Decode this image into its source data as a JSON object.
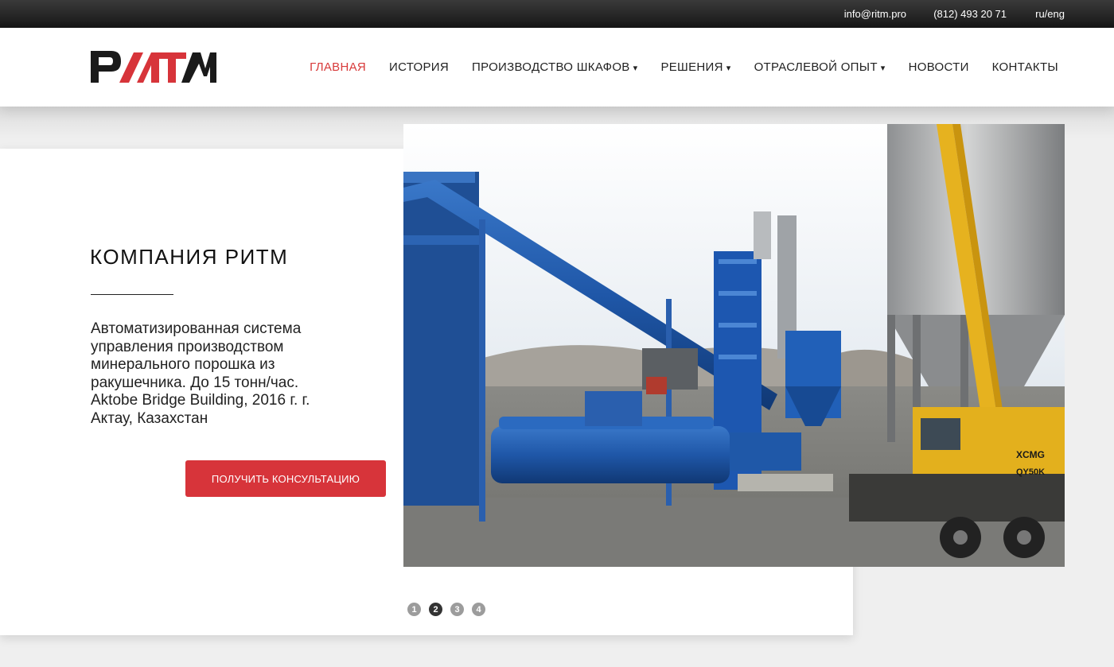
{
  "topbar": {
    "email": "info@ritm.pro",
    "phone": "(812) 493 20 71",
    "lang": "ru/eng"
  },
  "logo": {
    "text": "РИТМ"
  },
  "nav": [
    {
      "label": "ГЛАВНАЯ",
      "active": true
    },
    {
      "label": "ИСТОРИЯ"
    },
    {
      "label": "ПРОИЗВОДСТВО ШКАФОВ",
      "dropdown": true
    },
    {
      "label": "РЕШЕНИЯ",
      "dropdown": true
    },
    {
      "label": "ОТРАСЛЕВОЙ ОПЫТ",
      "dropdown": true
    },
    {
      "label": "НОВОСТИ"
    },
    {
      "label": "КОНТАКТЫ"
    }
  ],
  "caret": "▾",
  "slide": {
    "title": "КОМПАНИЯ РИТМ",
    "text": "Автоматизированная система управления производством минерального порошка из ракушечника. До 15 тонн/час. Aktobe Bridge Building, 2016 г. г. Актау, Казахстан",
    "button": "ПОЛУЧИТЬ КОНСУЛЬТАЦИЮ"
  },
  "photo": {
    "crane_brand": "XCMG",
    "crane_model": "QY50K"
  },
  "pager": [
    "1",
    "2",
    "3",
    "4"
  ],
  "pager_active": "2",
  "colors": {
    "accent": "#d7343a",
    "topbar": "#1e1e1e",
    "text": "#222222"
  }
}
